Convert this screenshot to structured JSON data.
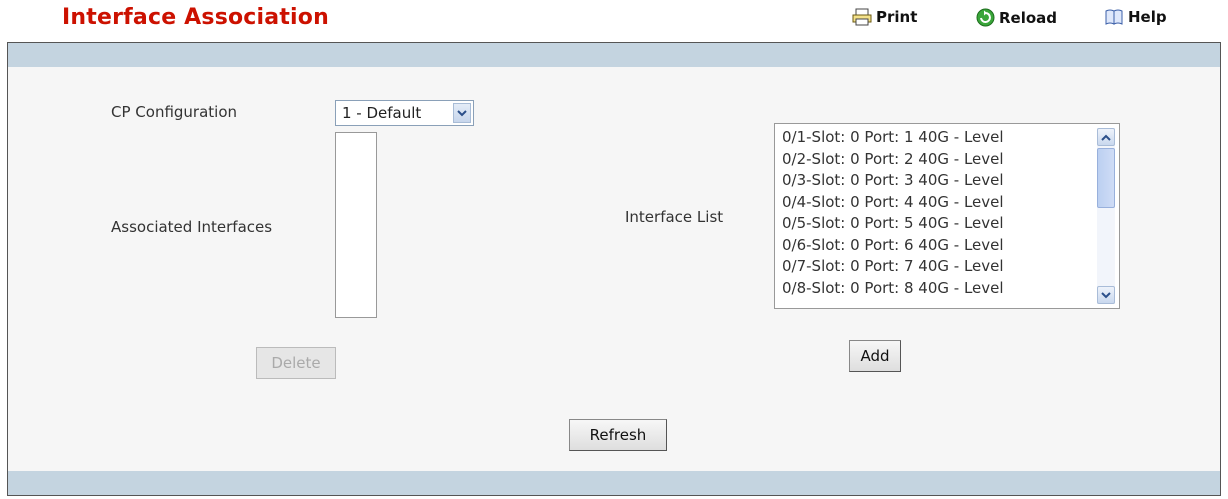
{
  "header": {
    "title": "Interface Association",
    "print_label": "Print",
    "reload_label": "Reload",
    "help_label": "Help"
  },
  "form": {
    "cp_config_label": "CP Configuration",
    "cp_config_selected": "1 - Default",
    "associated_label": "Associated Interfaces",
    "interface_list_label": "Interface List",
    "interfaces": [
      "0/1-Slot: 0 Port: 1 40G - Level",
      "0/2-Slot: 0 Port: 2 40G - Level",
      "0/3-Slot: 0 Port: 3 40G - Level",
      "0/4-Slot: 0 Port: 4 40G - Level",
      "0/5-Slot: 0 Port: 5 40G - Level",
      "0/6-Slot: 0 Port: 6 40G - Level",
      "0/7-Slot: 0 Port: 7 40G - Level",
      "0/8-Slot: 0 Port: 8 40G - Level"
    ]
  },
  "buttons": {
    "delete_label": "Delete",
    "add_label": "Add",
    "refresh_label": "Refresh"
  },
  "colors": {
    "title": "#cc1100",
    "bar": "#c4d4e0"
  }
}
